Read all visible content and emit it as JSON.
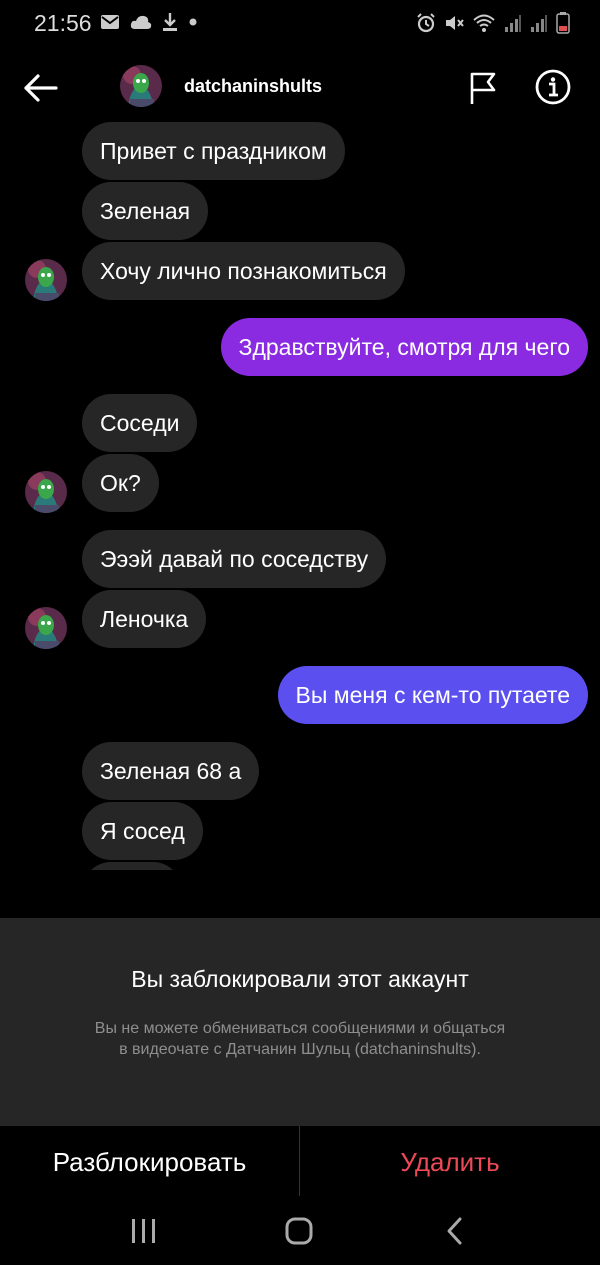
{
  "status_bar": {
    "time": "21:56",
    "left_icons": [
      "mail-icon",
      "cloud-icon",
      "download-icon",
      "dot-icon"
    ],
    "right_icons": [
      "alarm-icon",
      "mute-icon",
      "wifi-icon",
      "signal-icon",
      "signal-icon",
      "battery-icon"
    ]
  },
  "header": {
    "username": "datchaninshults",
    "back_icon": "arrow-left-icon",
    "report_icon": "flag-icon",
    "info_icon": "info-icon"
  },
  "messages": [
    {
      "direction": "in",
      "text": "Привет с праздником"
    },
    {
      "direction": "in",
      "text": "Зеленая"
    },
    {
      "direction": "in",
      "text": "Хочу  лично познакомиться"
    },
    {
      "direction": "out",
      "text": "Здравствуйте,  смотря для чего"
    },
    {
      "direction": "in",
      "text": "Соседи"
    },
    {
      "direction": "in",
      "text": "Ок?"
    },
    {
      "direction": "in",
      "text": "Эээй давай по соседству"
    },
    {
      "direction": "in",
      "text": "Леночка"
    },
    {
      "direction": "out",
      "text": "Вы меня с кем-то путаете"
    },
    {
      "direction": "in",
      "text": "Зеленая 68 а"
    },
    {
      "direction": "in",
      "text": "Я сосед"
    }
  ],
  "blocked": {
    "title": "Вы заблокировали этот аккаунт",
    "description": "Вы не можете обмениваться сообщениями и общаться в видеочате с Датчанин Шульц (datchaninshults)."
  },
  "actions": {
    "unblock_label": "Разблокировать",
    "delete_label": "Удалить"
  },
  "colors": {
    "outgoing_bubble_1": "#8a2be2",
    "outgoing_bubble_2": "#5b4ff0",
    "incoming_bubble": "#262626",
    "delete_red": "#ed4956",
    "panel_bg": "#262626"
  },
  "navbar": {
    "icons": [
      "recent-apps-icon",
      "home-icon",
      "back-icon"
    ]
  }
}
